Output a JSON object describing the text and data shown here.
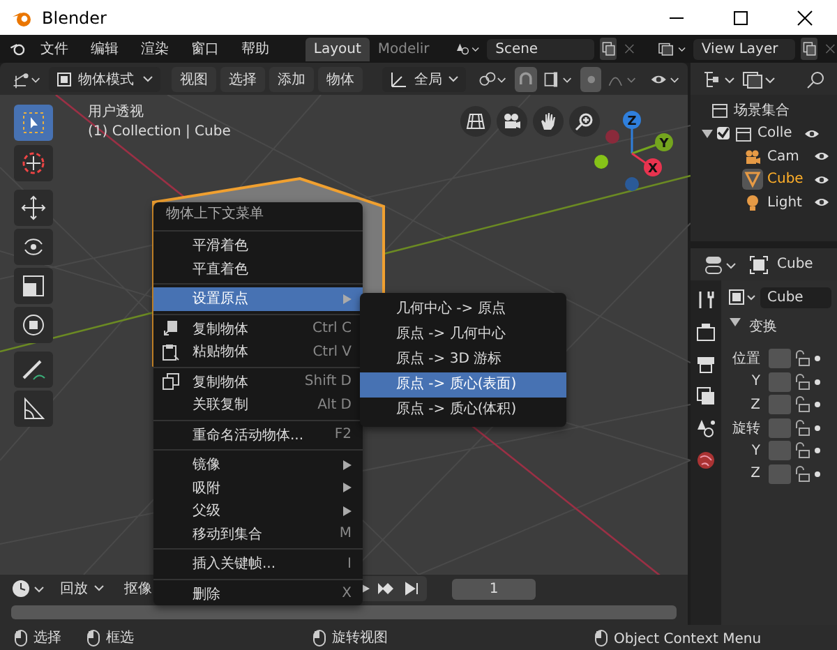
{
  "window": {
    "title": "Blender"
  },
  "menubar": [
    "文件",
    "编辑",
    "渲染",
    "窗口",
    "帮助"
  ],
  "workspace_tabs": [
    {
      "label": "Layout",
      "selected": true
    },
    {
      "label": "Modelir",
      "selected": false
    }
  ],
  "scene_field": {
    "value": "Scene"
  },
  "view_layer_field": {
    "value": "View Layer"
  },
  "viewport_header": {
    "mode": "物体模式",
    "menus": [
      "视图",
      "选择",
      "添加",
      "物体"
    ],
    "orientation": "全局"
  },
  "toolbar": [
    {
      "kind": "select-box",
      "selected": true
    },
    {
      "kind": "cursor",
      "selected": false
    },
    {
      "kind": "move",
      "selected": false
    },
    {
      "kind": "rotate",
      "selected": false
    },
    {
      "kind": "scale",
      "selected": false
    },
    {
      "kind": "transform",
      "selected": false
    },
    {
      "kind": "annotate",
      "selected": false
    },
    {
      "kind": "measure",
      "selected": false
    }
  ],
  "viewport": {
    "view_name": "用户透视",
    "object_info": "(1) Collection | Cube",
    "gizmo": [
      {
        "label": "Z",
        "color": "#2f7fdc"
      },
      {
        "label": "Y",
        "color": "#74a51e"
      },
      {
        "label": "X",
        "color": "#e8334f"
      }
    ]
  },
  "context_menu": {
    "title": "物体上下文菜单",
    "sections": [
      [
        {
          "label": "平滑着色",
          "kind": "plain",
          "selected": false
        },
        {
          "label": "平直着色",
          "kind": "plain",
          "selected": false
        }
      ],
      [
        {
          "label": "设置原点",
          "kind": "submenu",
          "selected": true
        }
      ],
      [
        {
          "label": "复制物体",
          "kind": "copy",
          "shortcut": "Ctrl C",
          "selected": false
        },
        {
          "label": "粘贴物体",
          "kind": "paste",
          "shortcut": "Ctrl V",
          "selected": false
        }
      ],
      [
        {
          "label": "复制物体",
          "kind": "duplicate",
          "shortcut": "Shift D",
          "selected": false
        },
        {
          "label": "关联复制",
          "kind": "plain",
          "shortcut": "Alt D",
          "selected": false
        }
      ],
      [
        {
          "label": "重命名活动物体...",
          "kind": "plain",
          "shortcut": "F2",
          "selected": false
        }
      ],
      [
        {
          "label": "镜像",
          "kind": "submenu",
          "selected": false
        },
        {
          "label": "吸附",
          "kind": "submenu",
          "selected": false
        },
        {
          "label": "父级",
          "kind": "submenu",
          "selected": false
        },
        {
          "label": "移动到集合",
          "kind": "plain",
          "shortcut": "M",
          "selected": false
        }
      ],
      [
        {
          "label": "插入关键帧...",
          "kind": "plain",
          "shortcut": "I",
          "selected": false
        }
      ],
      [
        {
          "label": "删除",
          "kind": "plain",
          "shortcut": "X",
          "selected": false
        }
      ]
    ]
  },
  "submenu": {
    "items": [
      {
        "label": "几何中心 -> 原点",
        "selected": false
      },
      {
        "label": "原点 -> 几何中心",
        "selected": false
      },
      {
        "label": "原点 -> 3D 游标",
        "selected": false
      },
      {
        "label": "原点 -> 质心(表面)",
        "selected": true
      },
      {
        "label": "原点 -> 质心(体积)",
        "selected": false
      }
    ]
  },
  "timeline": {
    "menus": [
      "回放",
      "抠像"
    ],
    "frame": "1"
  },
  "status_bar": [
    {
      "label": "选择"
    },
    {
      "label": "框选"
    },
    {
      "label": "旋转视图"
    },
    {
      "label": "Object Context Menu"
    }
  ],
  "outliner": {
    "root": "场景集合",
    "tree": [
      {
        "label": "Colle",
        "kind": "collection",
        "checked": true,
        "expanded": true,
        "selected": false,
        "children": [
          {
            "label": "Cam",
            "kind": "camera",
            "selected": false
          },
          {
            "label": "Cube",
            "kind": "mesh",
            "selected": true
          },
          {
            "label": "Light",
            "kind": "light",
            "selected": false
          }
        ]
      }
    ]
  },
  "properties": {
    "object": "Cube",
    "name_field": "Cube",
    "panel": {
      "title": "变换",
      "expanded": true,
      "rows": [
        {
          "label": "位置"
        },
        {
          "label": "Y"
        },
        {
          "label": "Z"
        },
        {
          "label": "旋转"
        },
        {
          "label": "Y"
        },
        {
          "label": "Z"
        }
      ]
    }
  }
}
